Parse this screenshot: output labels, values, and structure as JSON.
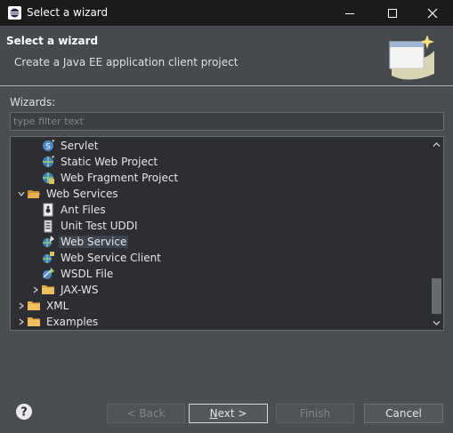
{
  "window": {
    "title": "Select a wizard"
  },
  "header": {
    "title": "Select a wizard",
    "description": "Create a Java EE application client project"
  },
  "wizards": {
    "label": "Wizards:",
    "filter_placeholder": "type filter text",
    "tree": [
      {
        "label": "Servlet",
        "icon": "servlet-icon",
        "level": 2,
        "expander": "none"
      },
      {
        "label": "Static Web Project",
        "icon": "static-web-project-icon",
        "level": 2,
        "expander": "none"
      },
      {
        "label": "Web Fragment Project",
        "icon": "web-fragment-project-icon",
        "level": 2,
        "expander": "none"
      },
      {
        "label": "Web Services",
        "icon": "folder-open-icon",
        "level": 1,
        "expander": "expanded"
      },
      {
        "label": "Ant Files",
        "icon": "ant-files-icon",
        "level": 2,
        "expander": "none"
      },
      {
        "label": "Unit Test UDDI",
        "icon": "unit-test-uddi-icon",
        "level": 2,
        "expander": "none"
      },
      {
        "label": "Web Service",
        "icon": "web-service-icon",
        "level": 2,
        "expander": "none",
        "selected": true
      },
      {
        "label": "Web Service Client",
        "icon": "web-service-client-icon",
        "level": 2,
        "expander": "none"
      },
      {
        "label": "WSDL File",
        "icon": "wsdl-file-icon",
        "level": 2,
        "expander": "none"
      },
      {
        "label": "JAX-WS",
        "icon": "folder-icon",
        "level": 2,
        "expander": "collapsed"
      },
      {
        "label": "XML",
        "icon": "folder-icon",
        "level": 1,
        "expander": "collapsed"
      },
      {
        "label": "Examples",
        "icon": "folder-icon",
        "level": 1,
        "expander": "collapsed"
      }
    ]
  },
  "buttons": {
    "back": "< Back",
    "next_mnemonic": "N",
    "next_rest": "ext >",
    "finish": "Finish",
    "cancel": "Cancel"
  },
  "colors": {
    "title_bar": "#1b1b1b",
    "dialog_bg": "#4a4d51",
    "tree_bg": "#2c2e31",
    "selection": "#3d4450",
    "folder": "#e8b04a"
  }
}
